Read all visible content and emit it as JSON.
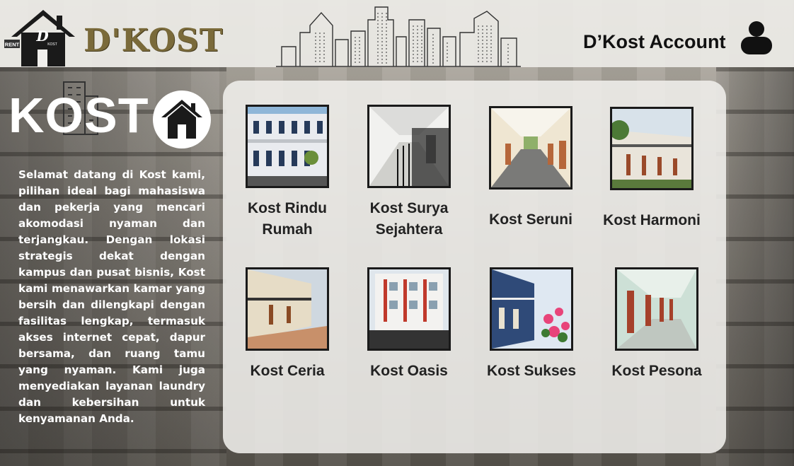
{
  "header": {
    "rent_sign": "RENT",
    "logo_letter": "D",
    "logo_sub": "KOST",
    "brand": "D'KOST",
    "account_label": "D’Kost Account"
  },
  "left": {
    "title": "KOST",
    "description": "Selamat datang di Kost kami, pilihan ideal bagi mahasiswa dan pekerja yang mencari akomodasi nyaman dan terjangkau. Dengan lokasi strategis dekat dengan kampus dan pusat bisnis, Kost kami menawarkan kamar yang bersih dan dilengkapi dengan fasilitas lengkap, termasuk akses internet cepat, dapur bersama, dan ruang tamu yang nyaman. Kami juga menyediakan layanan laundry dan kebersihan untuk kenyamanan Anda."
  },
  "listings": [
    {
      "name": "Kost Rindu Rumah"
    },
    {
      "name": "Kost Surya Sejahtera"
    },
    {
      "name": "Kost Seruni"
    },
    {
      "name": "Kost Harmoni"
    },
    {
      "name": "Kost Ceria"
    },
    {
      "name": "Kost Oasis"
    },
    {
      "name": "Kost Sukses"
    },
    {
      "name": "Kost Pesona"
    }
  ],
  "icons": {
    "logo": "house-logo-icon",
    "skyline": "city-skyline-icon",
    "account": "user-icon",
    "building": "building-icon",
    "home": "home-icon"
  },
  "colors": {
    "brand": "#7a6a3a",
    "panel": "#f0efec",
    "text_dark": "#222222"
  }
}
